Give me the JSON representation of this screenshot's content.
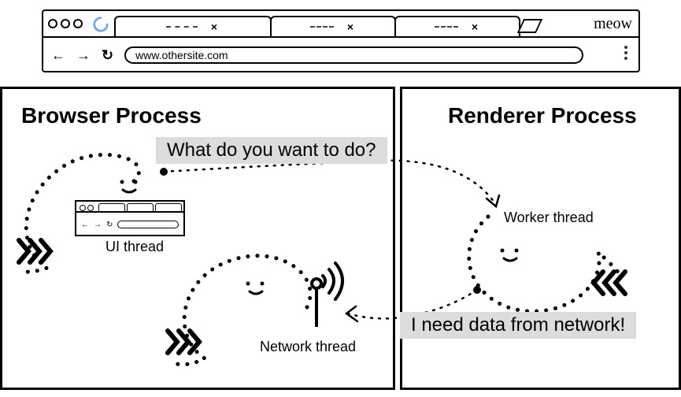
{
  "browser_window": {
    "url": "www.othersite.com",
    "brand": "meow",
    "tabs": [
      {
        "close": "×"
      },
      {
        "close": "×"
      },
      {
        "close": "×"
      }
    ],
    "nav": {
      "back": "←",
      "forward": "→",
      "reload": "↻"
    }
  },
  "processes": {
    "browser": {
      "title": "Browser Process"
    },
    "renderer": {
      "title": "Renderer Process"
    }
  },
  "threads": {
    "ui": "UI thread",
    "network": "Network thread",
    "worker": "Worker thread"
  },
  "messages": {
    "question": "What do you want to do?",
    "answer": "I need data from network!"
  },
  "mini_browser": {
    "nav": {
      "back": "←",
      "forward": "→",
      "reload": "↻"
    }
  }
}
